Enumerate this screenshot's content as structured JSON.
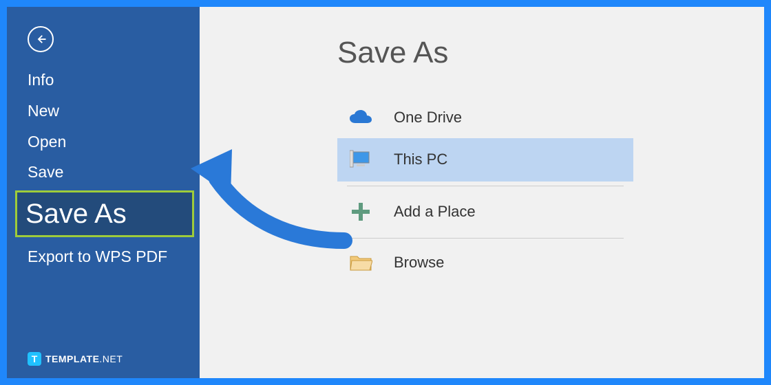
{
  "sidebar": {
    "items": [
      {
        "label": "Info"
      },
      {
        "label": "New"
      },
      {
        "label": "Open"
      },
      {
        "label": "Save"
      },
      {
        "label": "Save As",
        "selected": true
      },
      {
        "label": "Export to WPS PDF"
      }
    ]
  },
  "main": {
    "title": "Save As",
    "locations": [
      {
        "label": "One Drive",
        "icon": "cloud"
      },
      {
        "label": "This PC",
        "icon": "monitor",
        "selected": true
      },
      {
        "label": "Add a Place",
        "icon": "plus"
      },
      {
        "label": "Browse",
        "icon": "folder"
      }
    ]
  },
  "branding": {
    "badge_letter": "T",
    "name_bold": "TEMPLATE",
    "name_light": ".NET"
  },
  "colors": {
    "frame": "#1f87fb",
    "sidebar": "#295da2",
    "highlight_border": "#9ecc3a",
    "selection": "#bdd5f2"
  }
}
